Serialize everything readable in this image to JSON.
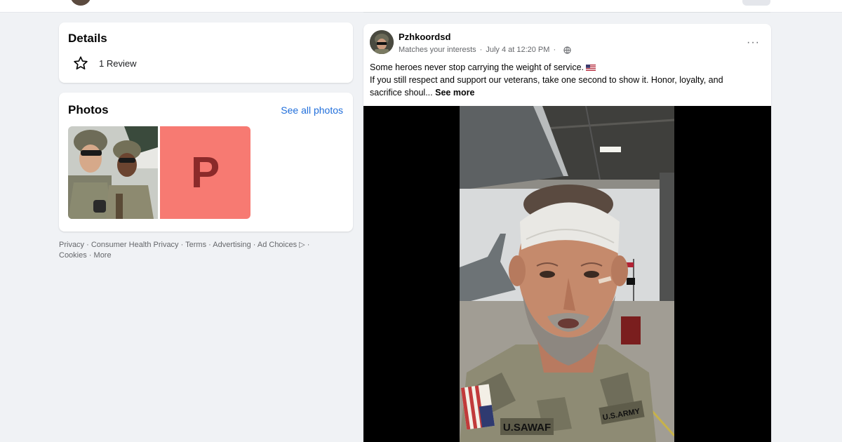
{
  "details": {
    "title": "Details",
    "review_text": "1 Review"
  },
  "photos": {
    "title": "Photos",
    "see_all": "See all photos",
    "placeholder_letter": "P"
  },
  "footer": {
    "links": [
      "Privacy",
      "Consumer Health Privacy",
      "Terms",
      "Advertising",
      "Ad Choices",
      "Cookies",
      "More"
    ],
    "separator": " · "
  },
  "post": {
    "author": "Pzhkoordsd",
    "context": "Matches your interests",
    "timestamp": "July 4 at 12:20 PM",
    "line1": "Some heroes never stop carrying the weight of service.",
    "line2": "If you still respect and support our veterans, take one second to show it. Honor, loyalty, and",
    "line3": "sacrifice shoul...",
    "see_more": "See more",
    "more_menu": "···",
    "name_tape": "U.S.ARMY",
    "name_tag": "U.SAWAF"
  },
  "colors": {
    "background": "#f0f2f5",
    "card": "#ffffff",
    "link": "#216fdb",
    "secondary_text": "#65676b",
    "placeholder_tile": "#f77a72"
  }
}
